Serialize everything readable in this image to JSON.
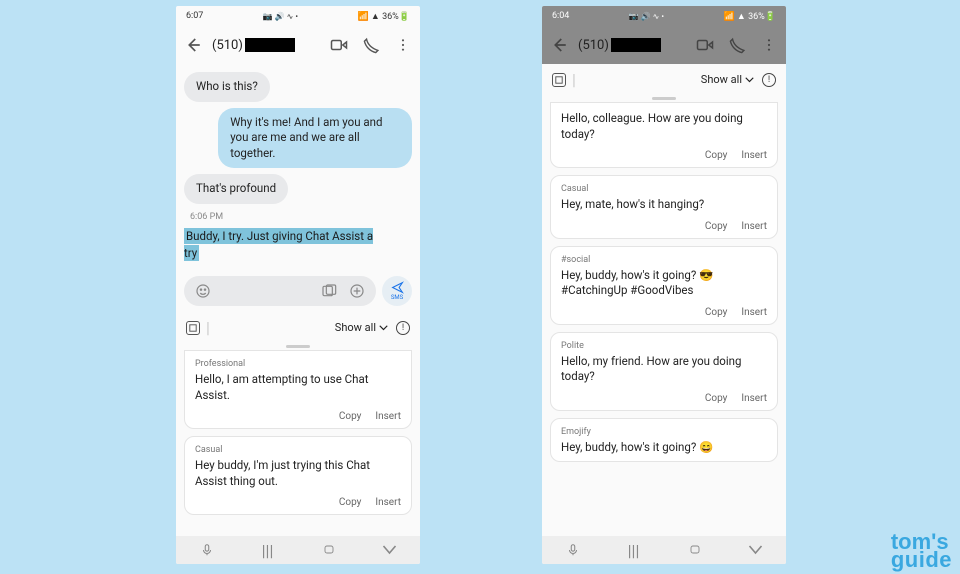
{
  "left": {
    "status": {
      "time": "6:07",
      "icons": "📷 🔊 ∿ •",
      "signal": "📶 ▲ 36%🔋"
    },
    "header": {
      "phone_prefix": "(510)"
    },
    "messages": [
      {
        "dir": "in",
        "text": "Who is this?"
      },
      {
        "dir": "out",
        "text": "Why it's me! And I am you and you are me and we are all together."
      },
      {
        "dir": "in",
        "text": "That's profound"
      }
    ],
    "timestamp": "6:06 PM",
    "draft": "Buddy, I try. Just giving Chat Assist a try",
    "send_label": "SMS",
    "showall": "Show all",
    "cards": [
      {
        "label": "Professional",
        "text": "Hello, I am attempting to use Chat Assist.",
        "copy": "Copy",
        "insert": "Insert",
        "cut": true
      },
      {
        "label": "Casual",
        "text": "Hey buddy, I'm just trying this Chat Assist thing out.",
        "copy": "Copy",
        "insert": "Insert"
      }
    ]
  },
  "right": {
    "status": {
      "time": "6:04",
      "icons": "📷 🔊 ∿ •",
      "signal": "📶 ▲ 36%🔋"
    },
    "header": {
      "phone_prefix": "(510)"
    },
    "showall": "Show all",
    "cards": [
      {
        "label": "",
        "text": "Hello, colleague. How are you doing today?",
        "copy": "Copy",
        "insert": "Insert",
        "cut": true
      },
      {
        "label": "Casual",
        "text": "Hey, mate, how's it hanging?",
        "copy": "Copy",
        "insert": "Insert"
      },
      {
        "label": "#social",
        "text": "Hey, buddy, how's it going? 😎 #CatchingUp #GoodVibes",
        "copy": "Copy",
        "insert": "Insert"
      },
      {
        "label": "Polite",
        "text": "Hello, my friend. How are you doing today?",
        "copy": "Copy",
        "insert": "Insert"
      },
      {
        "label": "Emojify",
        "text": "Hey, buddy, how's it going? 😄",
        "copy": "Copy",
        "insert": "Insert"
      }
    ]
  },
  "watermark": {
    "line1": "tom's",
    "line2": "guide"
  }
}
